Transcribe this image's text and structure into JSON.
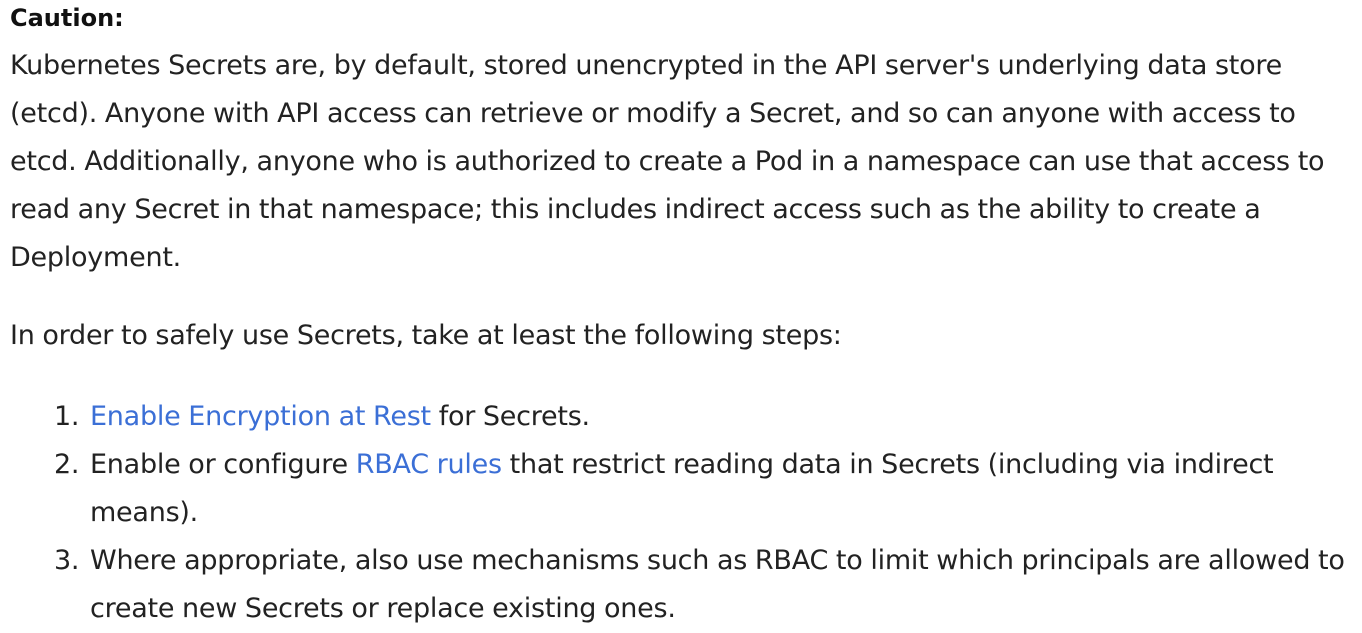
{
  "caution": {
    "title": "Caution:",
    "body": "Kubernetes Secrets are, by default, stored unencrypted in the API server's underlying data store (etcd). Anyone with API access can retrieve or modify a Secret, and so can anyone with access to etcd. Additionally, anyone who is authorized to create a Pod in a namespace can use that access to read any Secret in that namespace; this includes indirect access such as the ability to create a Deployment."
  },
  "intro": "In order to safely use Secrets, take at least the following steps:",
  "steps": [
    {
      "number": "1.",
      "before": "",
      "link": "Enable Encryption at Rest",
      "after": " for Secrets."
    },
    {
      "number": "2.",
      "before": "Enable or configure ",
      "link": "RBAC rules",
      "after": " that restrict reading data in Secrets (including via indirect means)."
    },
    {
      "number": "3.",
      "text": "Where appropriate, also use mechanisms such as RBAC to limit which principals are allowed to create new Secrets or replace existing ones."
    }
  ],
  "colors": {
    "text": "#222222",
    "link": "#3b6fd6"
  }
}
